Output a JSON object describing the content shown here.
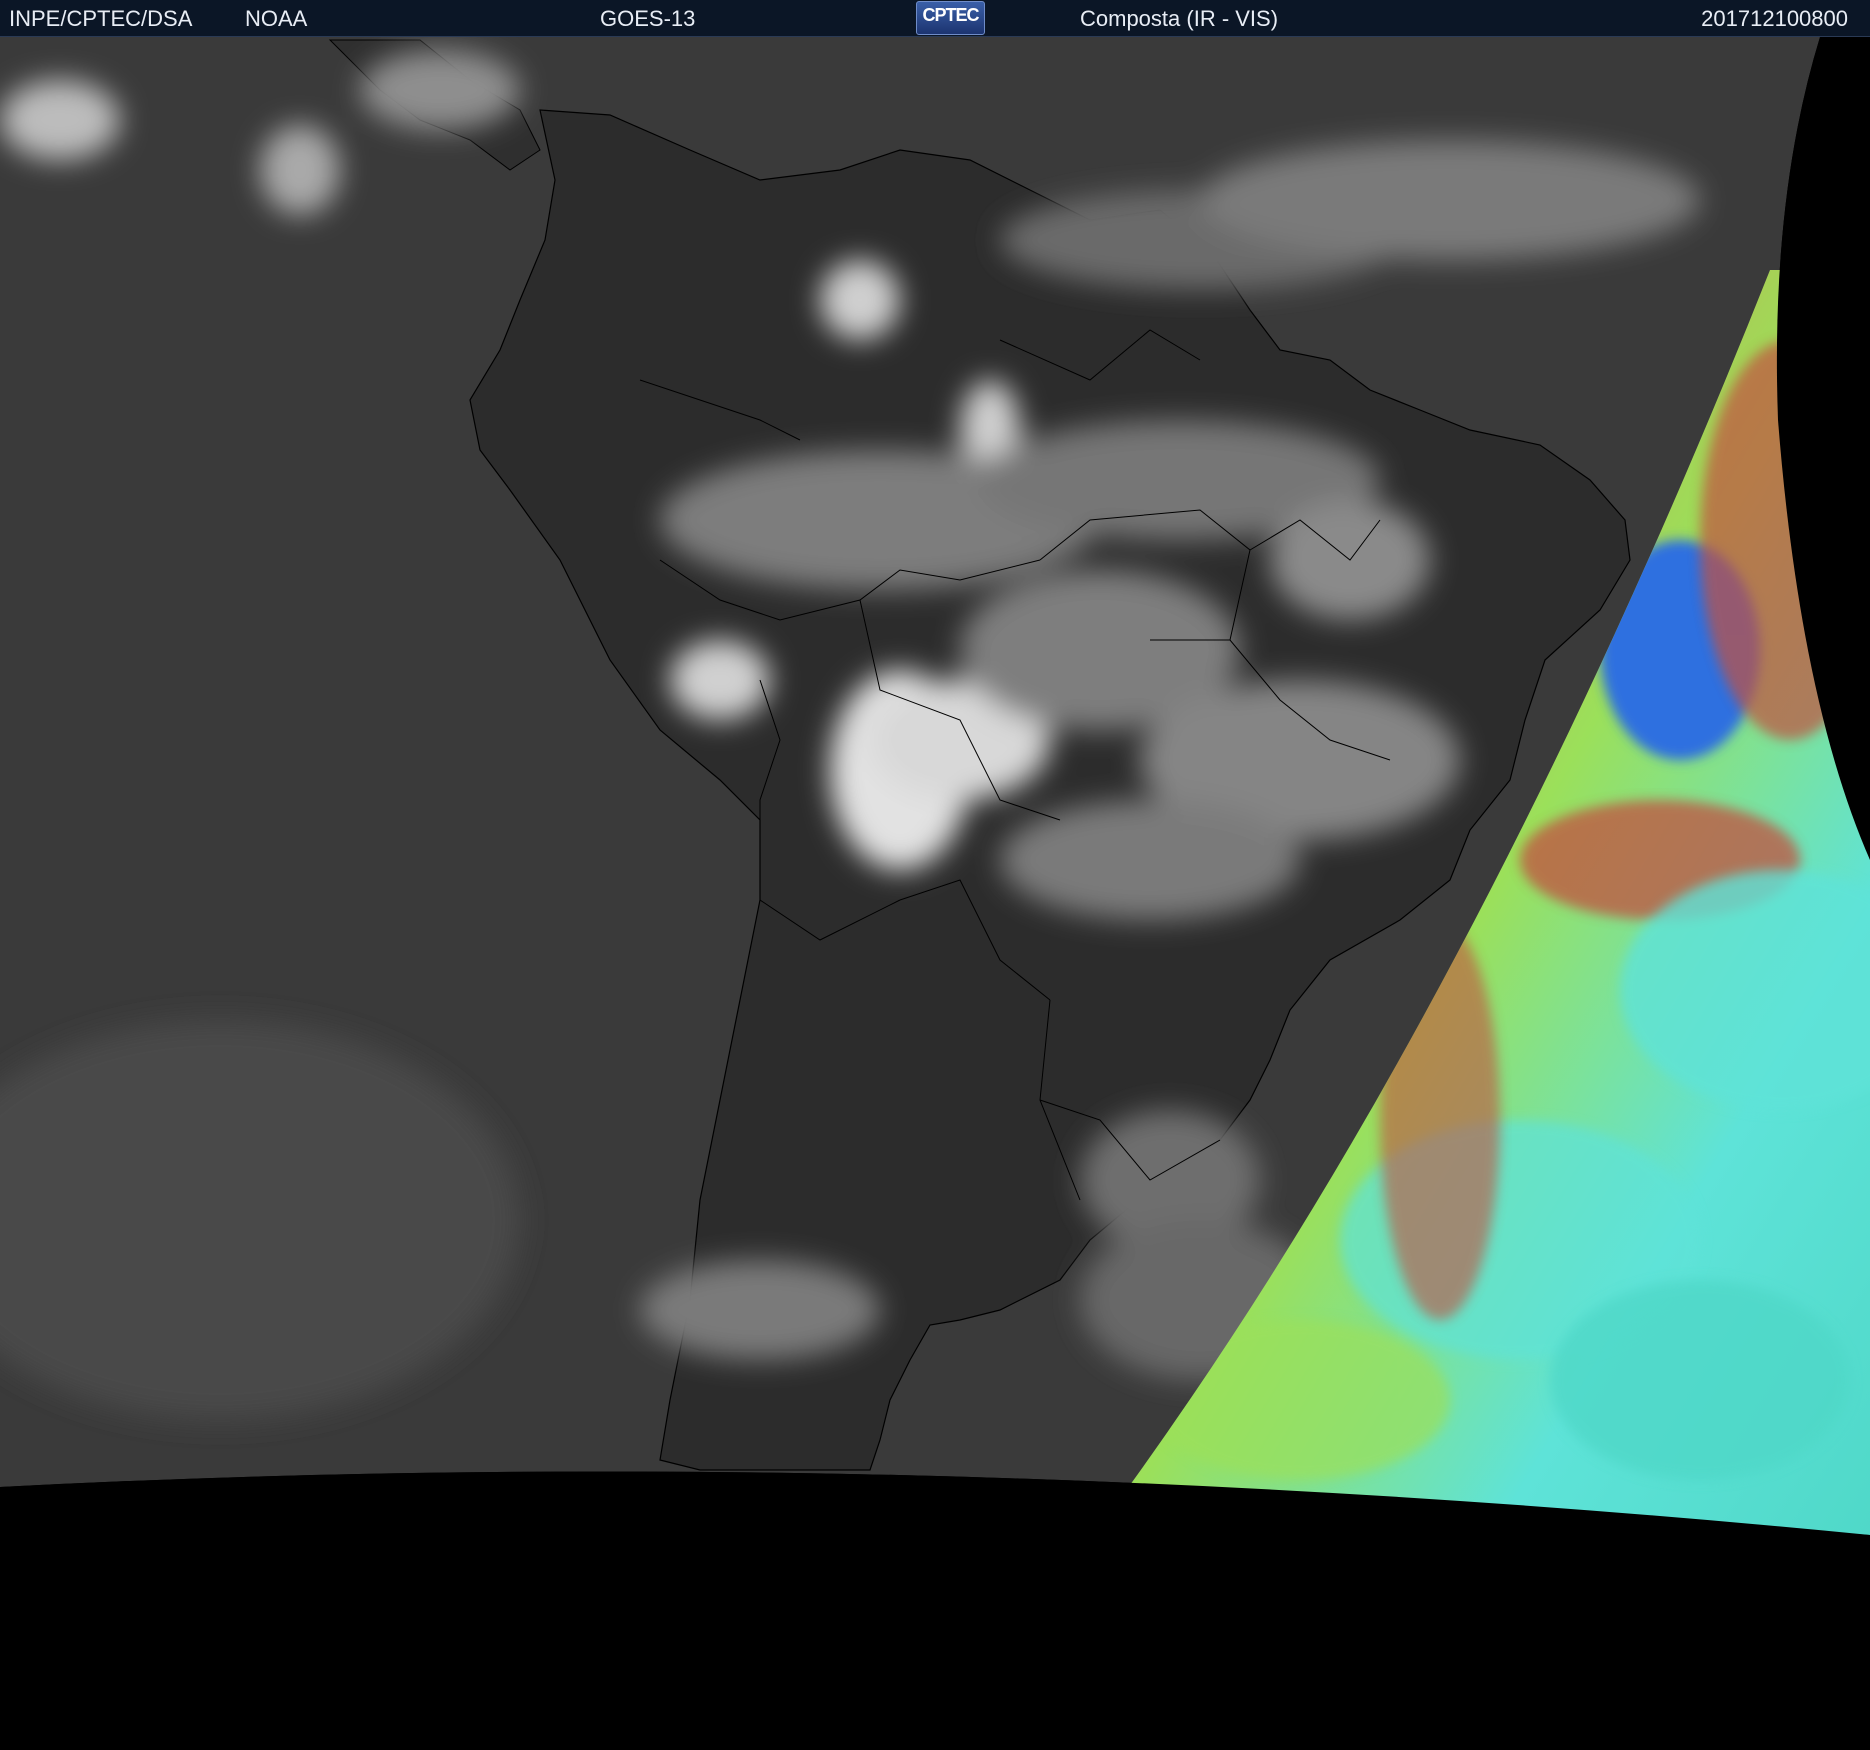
{
  "header": {
    "agency": "INPE/CPTEC/DSA",
    "provider": "NOAA",
    "satellite": "GOES-13",
    "logo_text": "CPTEC",
    "product": "Composta (IR - VIS)",
    "timestamp": "201712100800"
  },
  "colors": {
    "header_bg": "#0b1626",
    "header_text": "#e8edf5",
    "ocean_dark": "#3a3a3a",
    "land_dark": "#2b2b2b",
    "cloud": "#d9d9d9",
    "border_lines": "#000000",
    "night_pseudocolor": [
      "#c2513f",
      "#c9a24a",
      "#9be05a",
      "#5ee3d8",
      "#2f6fe0"
    ]
  }
}
